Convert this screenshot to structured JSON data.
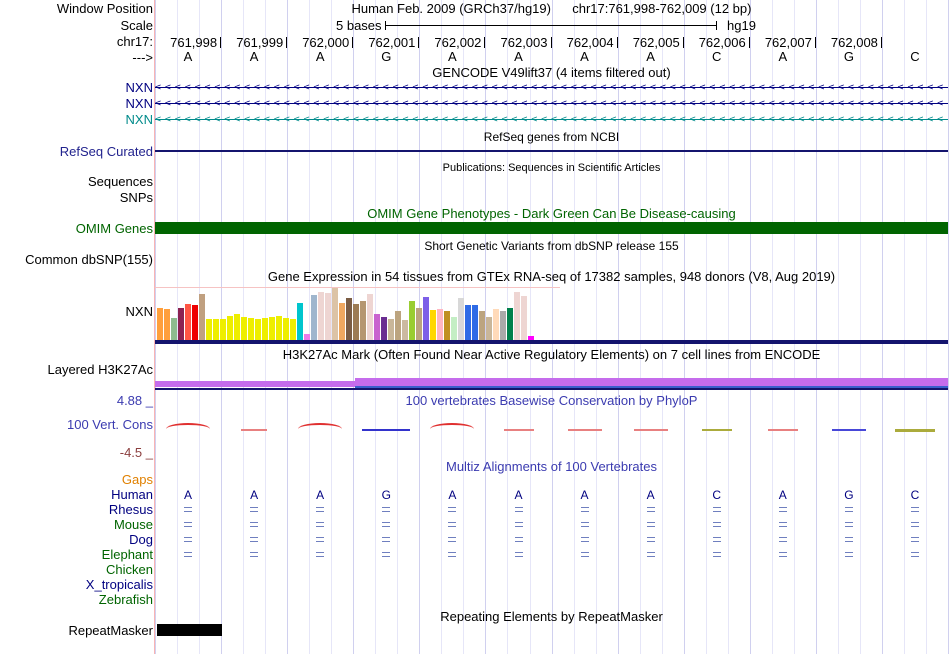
{
  "header": {
    "window_position_label": "Window Position",
    "assembly_title": "Human Feb. 2009 (GRCh37/hg19)",
    "position_title": "chr17:761,998-762,009 (12 bp)",
    "scale_label": "Scale",
    "scale_text": "5 bases",
    "assembly_tag": "hg19",
    "chrom_label": "chr17:",
    "strand_arrow": "--->",
    "coordinates": [
      "761,998",
      "761,999",
      "762,000",
      "762,001",
      "762,002",
      "762,003",
      "762,004",
      "762,005",
      "762,006",
      "762,007",
      "762,008"
    ],
    "sequence": [
      "A",
      "A",
      "A",
      "G",
      "A",
      "A",
      "A",
      "A",
      "C",
      "A",
      "G",
      "C"
    ]
  },
  "tracks": {
    "gencode": {
      "title": "GENCODE V49lift37 (4 items filtered out)",
      "items": [
        {
          "label": "NXN",
          "color": "#000080"
        },
        {
          "label": "NXN",
          "color": "#000080"
        },
        {
          "label": "NXN",
          "color": "#008B8B"
        }
      ]
    },
    "refseq": {
      "title": "RefSeq genes from NCBI",
      "label": "RefSeq Curated",
      "label_color": "#22238E"
    },
    "publications": {
      "title": "Publications: Sequences in Scientific Articles",
      "labels": [
        "Sequences",
        "SNPs"
      ]
    },
    "omim": {
      "title": "OMIM Gene Phenotypes - Dark Green Can Be Disease-causing",
      "label": "OMIM Genes",
      "color": "#006400"
    },
    "dbsnp": {
      "title": "Short Genetic Variants from dbSNP release 155",
      "label": "Common dbSNP(155)"
    },
    "gtex": {
      "title": "Gene Expression in 54 tissues from GTEx RNA-seq of 17382 samples, 948 donors (V8, Aug 2019)",
      "label": "NXN"
    },
    "h3k27ac": {
      "title": "H3K27Ac Mark (Often Found Near Active Regulatory Elements) on 7 cell lines from ENCODE",
      "label": "Layered H3K27Ac",
      "bar_color": "#C56CEC",
      "underline_color": "#3A5FCD"
    },
    "phylop": {
      "title": "100 vertebrates Basewise Conservation by PhyloP",
      "label": "100 Vert. Cons",
      "max_label": "4.88 _",
      "min_label": "-4.5 _",
      "label_color": "#3B3BB0",
      "min_color": "#8B3E3E"
    },
    "multiz": {
      "title": "Multiz Alignments of 100 Vertebrates",
      "species": [
        {
          "name": "Gaps",
          "color": "#E08000",
          "row": "empty"
        },
        {
          "name": "Human",
          "color": "#000080",
          "row": "bases"
        },
        {
          "name": "Rhesus",
          "color": "#000080",
          "row": "match"
        },
        {
          "name": "Mouse",
          "color": "#006400",
          "row": "match"
        },
        {
          "name": "Dog",
          "color": "#000080",
          "row": "match"
        },
        {
          "name": "Elephant",
          "color": "#006400",
          "row": "match"
        },
        {
          "name": "Chicken",
          "color": "#006400",
          "row": "empty"
        },
        {
          "name": "X_tropicalis",
          "color": "#000080",
          "row": "empty"
        },
        {
          "name": "Zebrafish",
          "color": "#006400",
          "row": "empty"
        }
      ],
      "match_symbol": "="
    },
    "repeatmasker": {
      "title": "Repeating Elements by RepeatMasker",
      "label": "RepeatMasker"
    }
  },
  "chart_data": [
    {
      "type": "bar",
      "title": "Gene Expression in 54 tissues from GTEx RNA-seq of 17382 samples, 948 donors (V8, Aug 2019)",
      "gene": "NXN",
      "n_tissues": 54,
      "ylabel": "relative expression (bar height, % of max bar)",
      "values": [
        62,
        60,
        42,
        62,
        70,
        67,
        88,
        40,
        40,
        40,
        46,
        50,
        44,
        42,
        40,
        42,
        44,
        46,
        42,
        40,
        72,
        12,
        87,
        93,
        91,
        100,
        72,
        80,
        70,
        75,
        88,
        50,
        45,
        40,
        55,
        38,
        75,
        62,
        82,
        58,
        60,
        55,
        45,
        80,
        68,
        68,
        55,
        45,
        60,
        55,
        62,
        92,
        85,
        8
      ],
      "bar_colors": [
        "#FF9F3C",
        "#FF9F3C",
        "#8FBC8F",
        "#8B2252",
        "#FF5544",
        "#EE0000",
        "#C0A080",
        "#EEEE00",
        "#EEEE00",
        "#EEEE00",
        "#EEEE00",
        "#EEEE00",
        "#EEEE00",
        "#EEEE00",
        "#EEEE00",
        "#EEEE00",
        "#EEEE00",
        "#EEEE00",
        "#EEEE00",
        "#EEEE00",
        "#00C5CD",
        "#EE7AE9",
        "#9FB6CD",
        "#EED5D2",
        "#EED5D2",
        "#DCC3A6",
        "#F0A860",
        "#7A5C44",
        "#9C7B55",
        "#B59670",
        "#EED5D2",
        "#C963CF",
        "#6A2D91",
        "#C9B699",
        "#BCA47F",
        "#CBB9A0",
        "#9ACD32",
        "#BCA47F",
        "#7D5FE8",
        "#FFD700",
        "#FFB6C1",
        "#C09020",
        "#C4EEC4",
        "#D8D8D8",
        "#2E6BE6",
        "#2E6BE6",
        "#BCA47F",
        "#C9B699",
        "#FFDAB9",
        "#A9A9A9",
        "#00804C",
        "#EED5D2",
        "#EED5D2",
        "#FF00FF"
      ],
      "baseline_color": "#14146E",
      "frame_color": "#F6C3C3"
    },
    {
      "type": "line",
      "title": "100 vertebrates Basewise Conservation by PhyloP",
      "ylim": [
        -4.5,
        4.88
      ],
      "x": [
        "761,998",
        "761,999",
        "762,000",
        "762,001",
        "762,002",
        "762,003",
        "762,004",
        "762,005",
        "762,006",
        "762,007",
        "762,008",
        "762,009"
      ],
      "marks": [
        {
          "shape": "arc-up",
          "color": "#E03030",
          "width": 44
        },
        {
          "shape": "flat",
          "color": "#E88080",
          "width": 26
        },
        {
          "shape": "arc-up",
          "color": "#E03030",
          "width": 44
        },
        {
          "shape": "flat",
          "color": "#3333CC",
          "width": 48
        },
        {
          "shape": "arc-up",
          "color": "#E03030",
          "width": 44
        },
        {
          "shape": "flat",
          "color": "#E88080",
          "width": 30
        },
        {
          "shape": "flat",
          "color": "#E88080",
          "width": 34
        },
        {
          "shape": "flat",
          "color": "#E88080",
          "width": 34
        },
        {
          "shape": "flat",
          "color": "#ABAB3C",
          "width": 30
        },
        {
          "shape": "flat",
          "color": "#E88080",
          "width": 30
        },
        {
          "shape": "flat",
          "color": "#4848D8",
          "width": 34
        },
        {
          "shape": "flat-thick",
          "color": "#ABAB3C",
          "width": 40
        }
      ]
    }
  ],
  "colors": {
    "navy": "#000080",
    "teal": "#008B8B",
    "dark_green": "#006400",
    "baseline_navy": "#14146E",
    "left_border_pink": "#F9B4B4",
    "grid": "#E6E6F8",
    "grid_dark": "#D0D0EF",
    "match_slate": "#6F7FBF",
    "repeat_black": "#000000"
  }
}
